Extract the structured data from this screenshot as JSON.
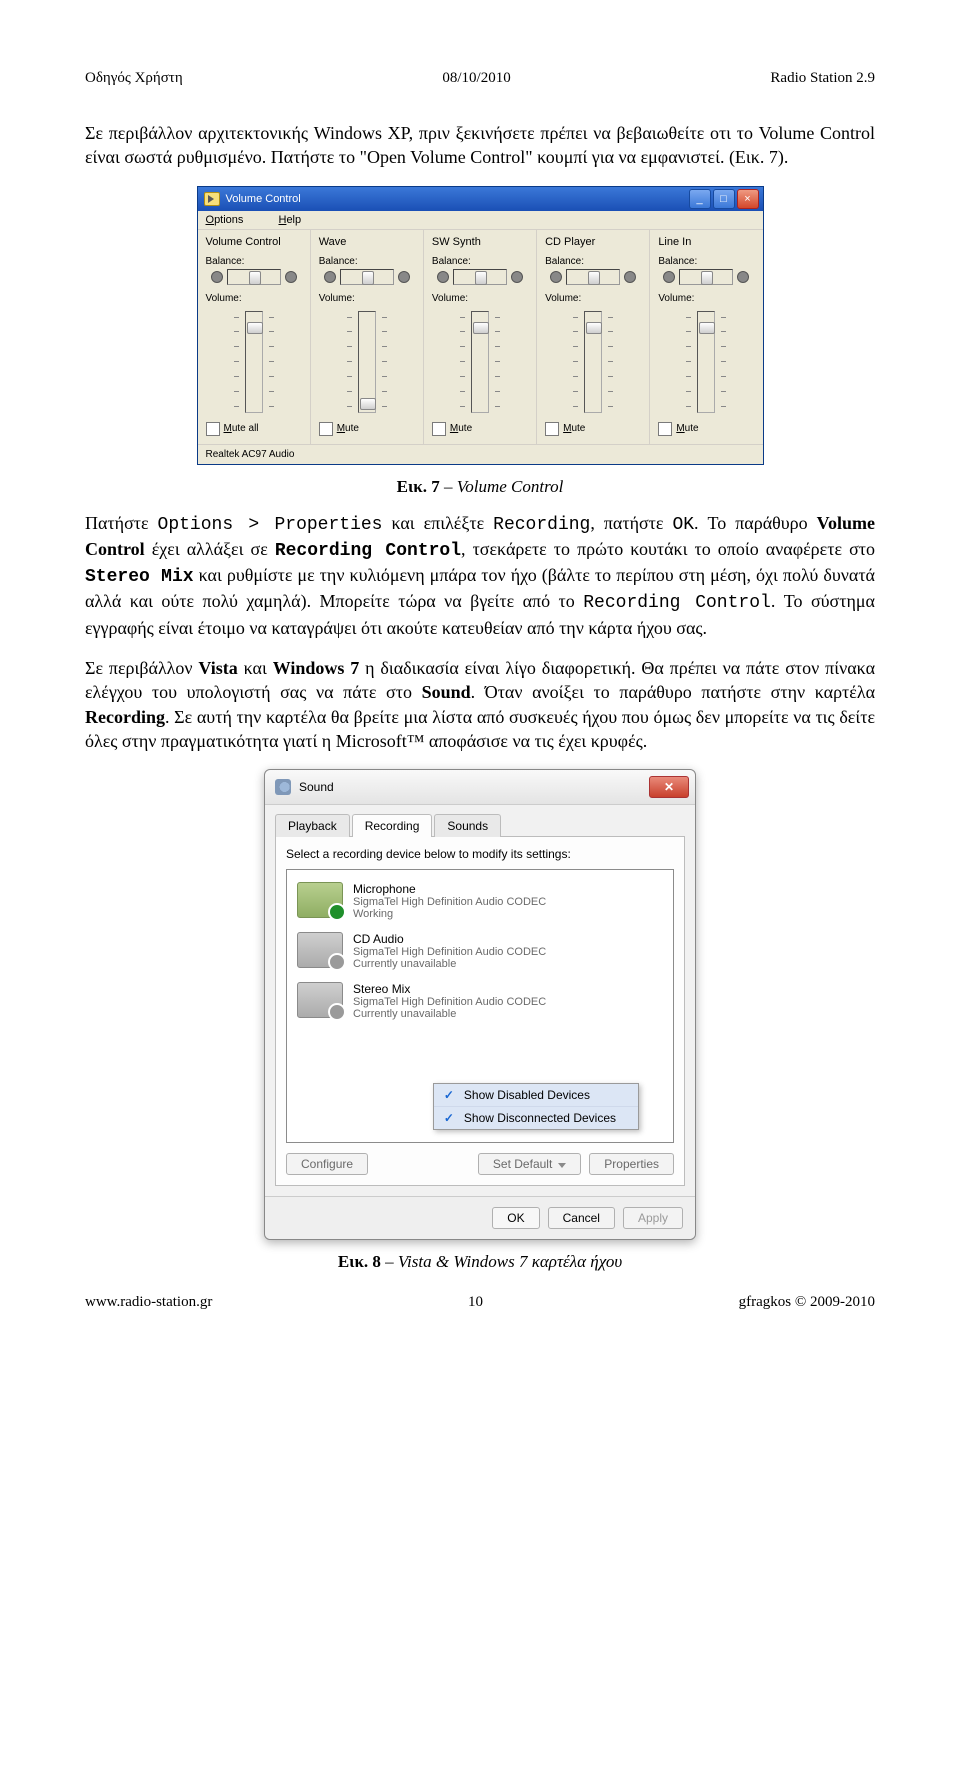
{
  "header": {
    "left": "Οδηγός Χρήστη",
    "center": "08/10/2010",
    "right": "Radio Station 2.9"
  },
  "para1": "Σε περιβάλλον αρχιτεκτονικής Windows XP, πριν ξεκινήσετε πρέπει να βεβαιωθείτε οτι το Volume Control είναι σωστά ρυθμισμένο. Πατήστε το \"Open Volume Control\" κουμπί για να εμφανιστεί. (Εικ. 7).",
  "volumeControl": {
    "title": "Volume Control",
    "menu_options": "Options",
    "menu_help": "Help",
    "balance_label": "Balance:",
    "volume_label": "Volume:",
    "mute_all": "Mute all",
    "mute": "Mute",
    "status": "Realtek AC97 Audio",
    "channels": [
      {
        "name": "Volume Control",
        "thumb": 10,
        "mute": "Mute all"
      },
      {
        "name": "Wave",
        "thumb": 86,
        "mute": "Mute"
      },
      {
        "name": "SW Synth",
        "thumb": 10,
        "mute": "Mute"
      },
      {
        "name": "CD Player",
        "thumb": 10,
        "mute": "Mute"
      },
      {
        "name": "Line In",
        "thumb": 10,
        "mute": "Mute"
      }
    ]
  },
  "caption1_bold": "Εικ. 7",
  "caption1_italic": " – Volume Control",
  "para2_a": "Πατήστε ",
  "para2_b": " και επιλέξτε ",
  "para2_c": ", πατήστε ",
  "para2_d": ". Το παράθυρο ",
  "para2_vc": "Volume Control",
  "para2_e": " έχει αλλάξει σε ",
  "para2_rc": "Recording Control",
  "para2_f": ", τσεκάρετε το πρώτο κουτάκι το οποίο αναφέρετε στο ",
  "para2_sm": "Stereo Mix",
  "para2_g": " και ρυθμίστε με την κυλιόμενη μπάρα τον ήχο (βάλτε το περίπου στη μέση, όχι πολύ δυνατά αλλά και ούτε πολύ χαμηλά). Μπορείτε τώρα να βγείτε από το ",
  "para2_rc2": "Recording Control",
  "para2_h": ". Το σύστημα εγγραφής είναι έτοιμο να καταγράψει ότι ακούτε κατευθείαν από την κάρτα ήχου σας.",
  "mono_opt": "Options > Properties",
  "mono_rec": "Recording",
  "mono_ok": "OK",
  "para3_a": "Σε περιβάλλον ",
  "para3_vista": "Vista",
  "para3_b": " και ",
  "para3_w7": "Windows 7",
  "para3_c": " η διαδικασία είναι λίγο διαφορετική. Θα πρέπει να πάτε στον πίνακα ελέγχου του υπολογιστή σας να πάτε στο ",
  "para3_sound": "Sound",
  "para3_d": ". Όταν ανοίξει το παράθυρο πατήστε στην καρτέλα ",
  "para3_recording": "Recording",
  "para3_e": ". Σε αυτή την καρτέλα θα βρείτε μια λίστα από συσκευές ήχου που όμως δεν μπορείτε να τις δείτε όλες στην πραγματικότητα γιατί η Microsoft™ αποφάσισε να τις έχει κρυφές.",
  "sound": {
    "title": "Sound",
    "tabs": [
      "Playback",
      "Recording",
      "Sounds"
    ],
    "active_tab": 1,
    "instruction": "Select a recording device below to modify its settings:",
    "devices": [
      {
        "name": "Microphone",
        "sub1": "SigmaTel High Definition Audio CODEC",
        "sub2": "Working",
        "gray": false
      },
      {
        "name": "CD Audio",
        "sub1": "SigmaTel High Definition Audio CODEC",
        "sub2": "Currently unavailable",
        "gray": true
      },
      {
        "name": "Stereo Mix",
        "sub1": "SigmaTel High Definition Audio CODEC",
        "sub2": "Currently unavailable",
        "gray": true
      }
    ],
    "context": [
      "Show Disabled Devices",
      "Show Disconnected Devices"
    ],
    "btn_configure": "Configure",
    "btn_setdefault": "Set Default",
    "btn_properties": "Properties",
    "btn_ok": "OK",
    "btn_cancel": "Cancel",
    "btn_apply": "Apply"
  },
  "caption2_bold": "Εικ. 8",
  "caption2_italic": " – Vista & Windows 7 καρτέλα ήχου",
  "footer": {
    "left": "www.radio-station.gr",
    "center": "10",
    "right": "gfragkos © 2009-2010"
  }
}
